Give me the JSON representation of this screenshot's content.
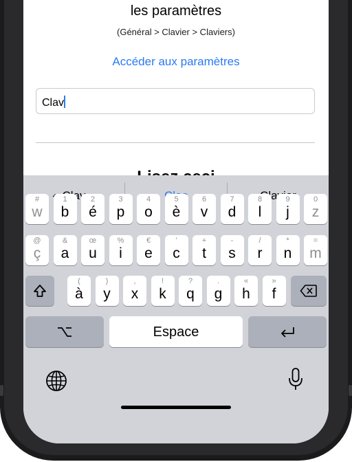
{
  "settings_panel": {
    "line1": "les paramètres",
    "line2": "(Général > Clavier > Claviers)",
    "link_label": "Accéder aux paramètres",
    "input_value": "Clav",
    "cut_heading": "Lisez ceci"
  },
  "keyboard": {
    "suggestions": [
      "« Clav »",
      "Clac",
      "Clavier"
    ],
    "row1": [
      {
        "alt": "#",
        "main": "w",
        "dim": true
      },
      {
        "alt": "1",
        "main": "b"
      },
      {
        "alt": "2",
        "main": "é"
      },
      {
        "alt": "3",
        "main": "p"
      },
      {
        "alt": "4",
        "main": "o"
      },
      {
        "alt": "5",
        "main": "è"
      },
      {
        "alt": "6",
        "main": "v"
      },
      {
        "alt": "7",
        "main": "d"
      },
      {
        "alt": "8",
        "main": "l"
      },
      {
        "alt": "9",
        "main": "j"
      },
      {
        "alt": "0",
        "main": "z",
        "dim": true
      }
    ],
    "row2": [
      {
        "alt": "@",
        "main": "ç",
        "dim": true
      },
      {
        "alt": "&",
        "main": "a"
      },
      {
        "alt": "œ",
        "main": "u"
      },
      {
        "alt": "%",
        "main": "i"
      },
      {
        "alt": "€",
        "main": "e"
      },
      {
        "alt": "’",
        "main": "c"
      },
      {
        "alt": "+",
        "main": "t"
      },
      {
        "alt": "-",
        "main": "s"
      },
      {
        "alt": "/",
        "main": "r"
      },
      {
        "alt": "*",
        "main": "n"
      },
      {
        "alt": "=",
        "main": "m",
        "dim": true
      }
    ],
    "row3": [
      {
        "alt": "(",
        "main": "à"
      },
      {
        "alt": ")",
        "main": "y"
      },
      {
        "alt": ",",
        "main": "x"
      },
      {
        "alt": "!",
        "main": "k"
      },
      {
        "alt": "?",
        "main": "q"
      },
      {
        "alt": ".",
        "main": "g"
      },
      {
        "alt": "«",
        "main": "h"
      },
      {
        "alt": "»",
        "main": "f"
      }
    ],
    "space_label": "Espace",
    "icons": {
      "shift": "shift-icon",
      "delete": "delete-icon",
      "option": "option-icon",
      "return": "return-icon",
      "globe": "globe-icon",
      "mic": "mic-icon"
    }
  },
  "colors": {
    "accent": "#2a7af2",
    "keyboard_bg": "#d1d3d9",
    "key_bg": "#ffffff",
    "fn_key_bg": "#abb0ba"
  }
}
